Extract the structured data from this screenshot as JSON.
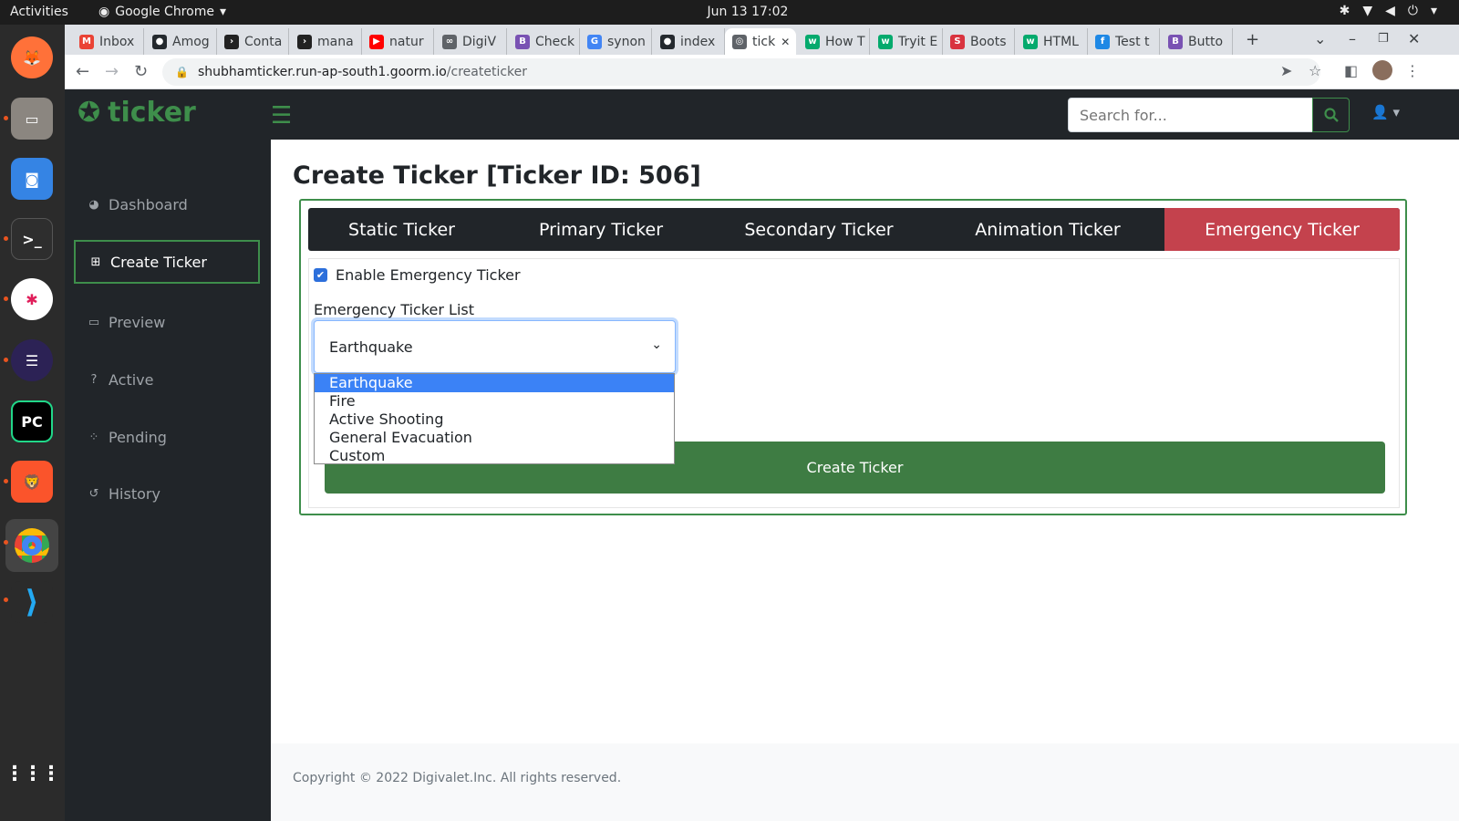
{
  "system": {
    "activities": "Activities",
    "app_name": "Google Chrome",
    "clock": "Jun 13  17:02"
  },
  "browser": {
    "tabs": [
      {
        "label": "Inbox",
        "icon": "gmail-icon",
        "color": "#ea4335"
      },
      {
        "label": "Amog",
        "icon": "github-icon",
        "color": "#24292e"
      },
      {
        "label": "Conta",
        "icon": "terminal-icon",
        "color": "#222222"
      },
      {
        "label": "mana",
        "icon": "terminal-icon",
        "color": "#222222"
      },
      {
        "label": "natur",
        "icon": "youtube-icon",
        "color": "#ff0000"
      },
      {
        "label": "DigiV",
        "icon": "link-icon",
        "color": "#5f6368"
      },
      {
        "label": "Check",
        "icon": "bootstrap-icon",
        "color": "#7952b3"
      },
      {
        "label": "synon",
        "icon": "google-icon",
        "color": "#4285f4"
      },
      {
        "label": "index",
        "icon": "github-icon",
        "color": "#24292e"
      },
      {
        "label": "tick",
        "icon": "globe-icon",
        "color": "#5f6368"
      },
      {
        "label": "How T",
        "icon": "w3schools-icon",
        "color": "#04aa6d"
      },
      {
        "label": "Tryit E",
        "icon": "w3schools-icon",
        "color": "#04aa6d"
      },
      {
        "label": "Boots",
        "icon": "s-icon",
        "color": "#d9333f"
      },
      {
        "label": "HTML",
        "icon": "w3schools-icon",
        "color": "#04aa6d"
      },
      {
        "label": "Test t",
        "icon": "f-icon",
        "color": "#1e88e5"
      },
      {
        "label": "Butto",
        "icon": "bootstrap-icon",
        "color": "#7952b3"
      }
    ],
    "url_host": "shubhamticker.run-ap-south1.goorm.io",
    "url_path": "/createticker"
  },
  "app": {
    "brand": "ticker",
    "search_placeholder": "Search for...",
    "accent_color": "#3e8e4b",
    "danger_color": "#c4424d"
  },
  "sidebar": {
    "items": [
      {
        "label": "Dashboard",
        "icon": "dashboard-icon"
      },
      {
        "label": "Create Ticker",
        "icon": "plus-square-icon"
      },
      {
        "label": "Preview",
        "icon": "monitor-icon"
      },
      {
        "label": "Active",
        "icon": "question-circle-icon"
      },
      {
        "label": "Pending",
        "icon": "spinner-icon"
      },
      {
        "label": "History",
        "icon": "history-icon"
      }
    ]
  },
  "main": {
    "title": "Create Ticker [Ticker ID: 506]",
    "tabs": [
      "Static Ticker",
      "Primary Ticker",
      "Secondary Ticker",
      "Animation Ticker",
      "Emergency Ticker"
    ],
    "enable_label": "Enable Emergency Ticker",
    "list_label": "Emergency Ticker List",
    "selected": "Earthquake",
    "options": [
      "Earthquake",
      "Fire",
      "Active Shooting",
      "General Evacuation",
      "Custom"
    ],
    "create_button": "Create Ticker"
  },
  "footer": {
    "copyright": "Copyright © 2022 Digivalet.Inc. All rights reserved."
  }
}
